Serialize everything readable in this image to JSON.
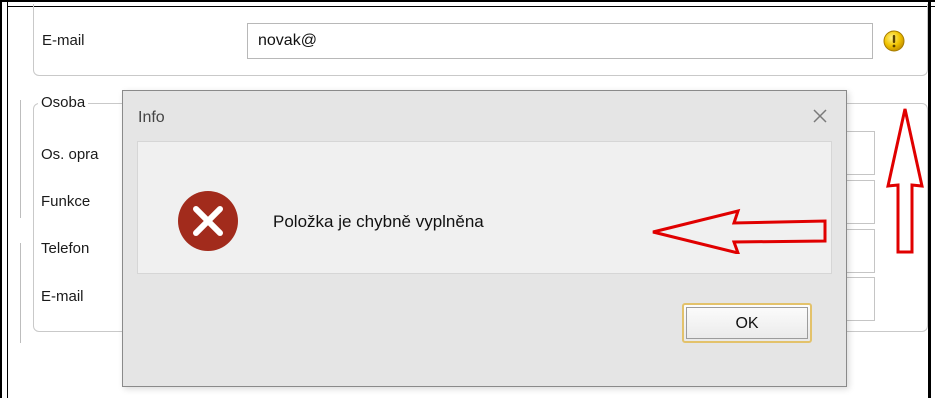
{
  "contact_section": {
    "email_label": "E-mail",
    "email_value": "novak@"
  },
  "person_section": {
    "legend": "Osoba",
    "fields": [
      {
        "label": "Os. opra"
      },
      {
        "label": "Funkce"
      },
      {
        "label": "Telefon"
      },
      {
        "label": "E-mail"
      }
    ]
  },
  "warning_icon": {
    "name": "warning-icon",
    "color": "#f2c400"
  },
  "dialog": {
    "title": "Info",
    "message": "Položka je chybně vyplněna",
    "ok_label": "OK",
    "icon": {
      "name": "error-icon",
      "color": "#a22b1c"
    }
  },
  "annotations": {
    "arrow_color": "#e00000"
  }
}
